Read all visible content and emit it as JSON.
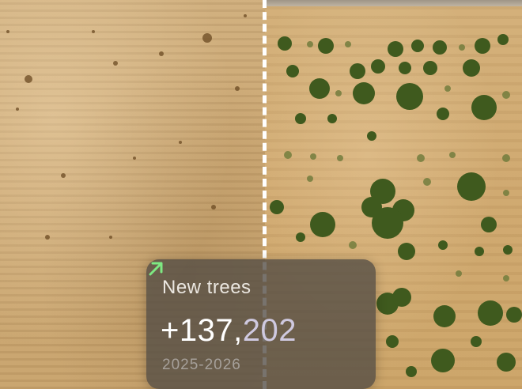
{
  "comparison": {
    "left_label": "",
    "right_label": ""
  },
  "card": {
    "title": "New trees",
    "value_main": "+137,",
    "value_tail": "202",
    "period": "2025-2026",
    "arrow_icon": "arrow-up-right-icon",
    "accent_color": "#7ee882"
  }
}
